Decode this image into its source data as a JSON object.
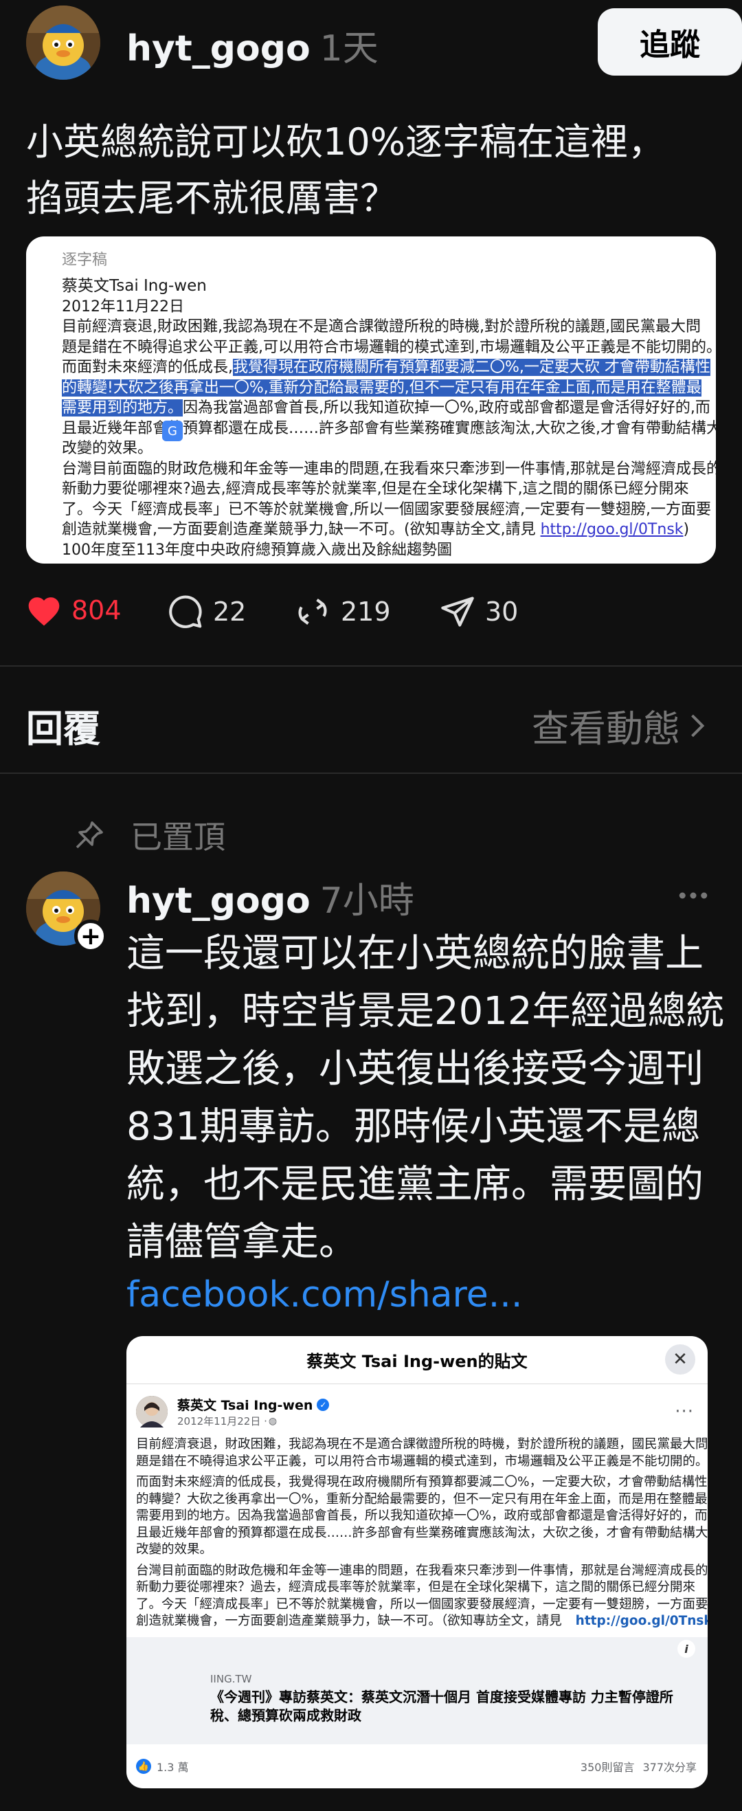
{
  "post": {
    "username": "hyt_gogo",
    "time": "1天",
    "follow_label": "追蹤",
    "text_line1": "小英總統說可以砍10%逐字稿在這裡，",
    "text_line2": "掐頭去尾不就很厲害？"
  },
  "document_image": {
    "header": "逐字稿",
    "author": "蔡英文Tsai Ing-wen",
    "date": "2012年11月22日",
    "lines": [
      "目前經濟衰退,財政困難,我認為現在不是適合課徵證所稅的時機,對於證所稅的議題,國民黨最大問",
      "題是錯在不曉得追求公平正義,可以用符合市場邏輯的模式達到,市場邏輯及公平正義是不能切開的。"
    ],
    "line3_pre": "而面對未來經濟的低成長,",
    "line3_hl": "我覺得現在政府機關所有預算都要減二〇%,一定要大砍 才會帶動結構性",
    "line4_hl": "的轉變!大砍之後再拿出一〇%,重新分配給最需要的,但不一定只有用在年金上面,而是用在整體最",
    "line5_hl": "需要用到的地方。",
    "line5_post": "因為我當過部會首長,所以我知道砍掉一〇%,政府或部會都還是會活得好好的,而",
    "line6": "且最近幾年部會的預算都還在成長……許多部會有些業務確實應該淘汰,大砍之後,才會有帶動結構大",
    "line7": "改變的效果。",
    "line8": "台灣目前面臨的財政危機和年金等一連串的問題,在我看來只牽涉到一件事情,那就是台灣經濟成長的",
    "line9": "新動力要從哪裡來?過去,經濟成長率等於就業率,但是在全球化架構下,這之間的關係已經分開來",
    "line10": "了。今天「經濟成長率」已不等於就業機會,所以一個國家要發展經濟,一定要有一雙翅膀,一方面要",
    "line11_pre": "創造就業機會,一方面要創造產業競爭力,缺一不可。(欲知專訪全文,請見 ",
    "line11_link": "http://goo.gl/0Tnsk",
    "line11_post": ")",
    "line12": "100年度至113年度中央政府總預算歲入歲出及餘絀趨勢圖"
  },
  "actions": {
    "likes": "804",
    "comments": "22",
    "reposts": "219",
    "shares": "30"
  },
  "replies_section": {
    "title": "回覆",
    "view_activity": "查看動態"
  },
  "reply": {
    "pinned_label": "已置頂",
    "username": "hyt_gogo",
    "time": "7小時",
    "text_lines": [
      "這一段還可以在小英總統的臉書上",
      "找到，時空背景是2012年經過總統",
      "敗選之後，小英復出後接受今週刊",
      "831期專訪。那時候小英還不是總",
      "統，也不是民進黨主席。需要圖的",
      "請儘管拿走。"
    ],
    "link": "facebook.com/share..."
  },
  "fb_card": {
    "title": "蔡英文 Tsai Ing-wen的貼文",
    "author": "蔡英文 Tsai Ing-wen",
    "date": "2012年11月22日 · ",
    "para1": [
      "目前經濟衰退，財政困難，我認為現在不是適合課徵證所稅的時機，對於證所稅的議題，國民黨最大問",
      "題是錯在不曉得追求公平正義，可以用符合市場邏輯的模式達到，市場邏輯及公平正義是不能切開的。"
    ],
    "para2": [
      "而面對未來經濟的低成長，我覺得現在政府機關所有預算都要減二〇%，一定要大砍，才會帶動結構性",
      "的轉變？大砍之後再拿出一〇%，重新分配給最需要的，但不一定只有用在年金上面，而是用在整體最",
      "需要用到的地方。因為我當過部會首長，所以我知道砍掉一〇%，政府或部會都還是會活得好好的，而",
      "且最近幾年部會的預算都還在成長……許多部會有些業務確實應該淘汰，大砍之後，才會有帶動結構大",
      "改變的效果。"
    ],
    "para3": [
      "台灣目前面臨的財政危機和年金等一連串的問題，在我看來只牽涉到一件事情，那就是台灣經濟成長的",
      "新動力要從哪裡來？過去，經濟成長率等於就業率，但是在全球化架構下，這之間的關係已經分開來",
      "了。今天「經濟成長率」已不等於就業機會，所以一個國家要發展經濟，一定要有一雙翅膀，一方面要"
    ],
    "last_line": "創造就業機會，一方面要創造產業競爭力，缺一不可。（欲知專訪全文，請見",
    "last_link": "http://goo.gl/0Tnsk",
    "last_close": "）",
    "preview_domain": "IING.TW",
    "preview_title_1": "《今週刊》專訪蔡英文：蔡英文沉潛十個月 首度接受媒體專訪 力主暫停證所",
    "preview_title_2": "稅、總預算砍兩成救財政",
    "reactions": "1.3 萬",
    "comments": "350則留言",
    "shares": "377次分享"
  },
  "colors": {
    "background": "#101010",
    "like_red": "#ff3040",
    "link_blue": "#2f8cf5",
    "muted": "#777777"
  }
}
